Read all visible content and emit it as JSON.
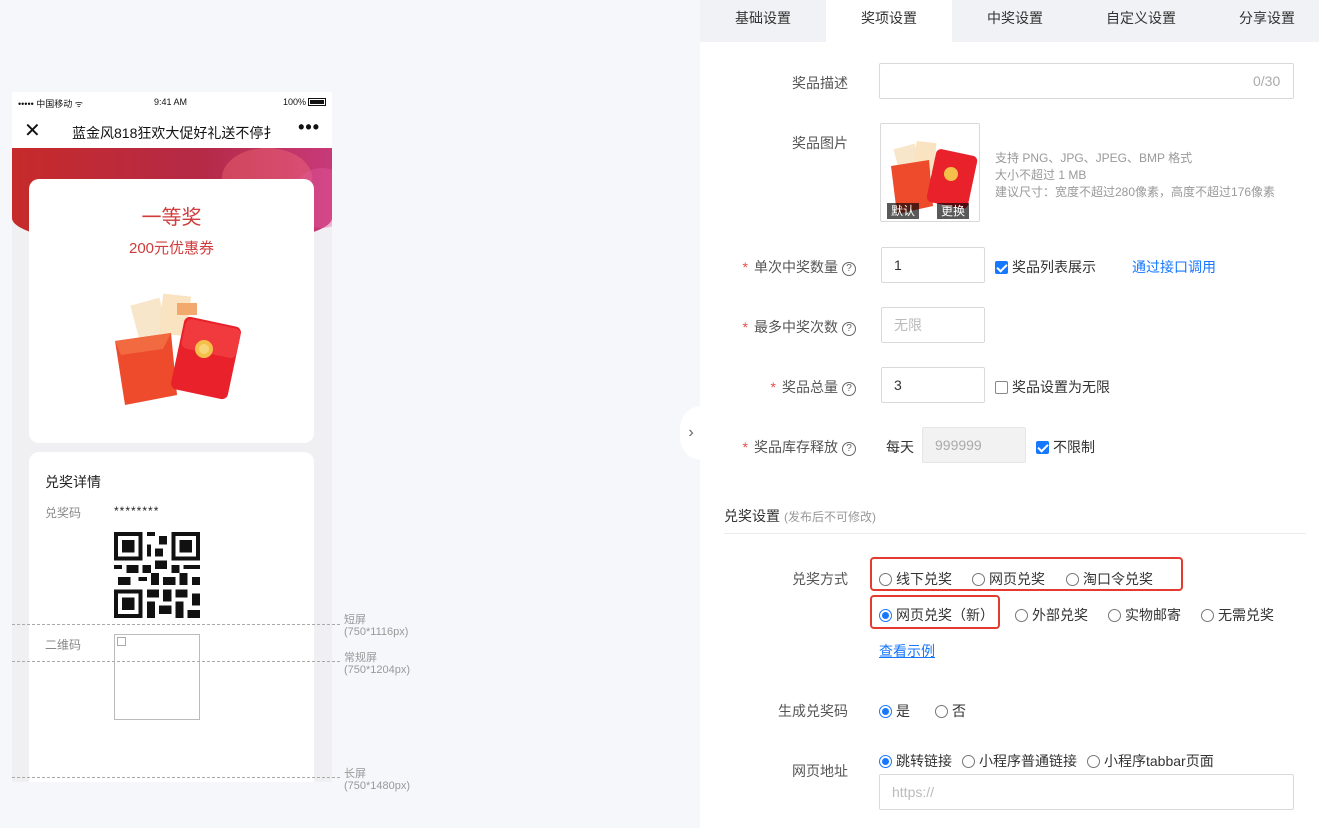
{
  "preview": {
    "status": {
      "carrier": "••••• 中国移动 ᯤ",
      "time": "9:41 AM",
      "battery": "100%"
    },
    "nav_title": "蓝金风818狂欢大促好礼送不停扌",
    "close_glyph": "✕",
    "more_glyph": "•••",
    "prize_title": "一等奖",
    "prize_sub": "200元优惠券",
    "detail_title": "兑奖详情",
    "code_label": "兑奖码",
    "code_value": "********",
    "qr_label": "二维码"
  },
  "screen_marks": [
    {
      "name": "短屏",
      "size": "(750*1116px)"
    },
    {
      "name": "常规屏",
      "size": "(750*1204px)"
    },
    {
      "name": "长屏",
      "size": "(750*1480px)"
    }
  ],
  "collapse_glyph": "›",
  "tabs": [
    "基础设置",
    "奖项设置",
    "中奖设置",
    "自定义设置",
    "分享设置"
  ],
  "active_tab": 1,
  "form": {
    "desc_label": "奖品描述",
    "desc_value": "",
    "desc_counter": "0/30",
    "image_label": "奖品图片",
    "image_default_btn": "默认",
    "image_change_btn": "更换",
    "image_tips": [
      "支持 PNG、JPG、JPEG、BMP 格式",
      "大小不超过 1 MB",
      "建议尺寸：宽度不超过280像素，高度不超过176像素"
    ],
    "single_label": "单次中奖数量",
    "single_value": "1",
    "single_show_list": "奖品列表展示",
    "single_link": "通过接口调用",
    "max_label": "最多中奖次数",
    "max_placeholder": "无限",
    "total_label": "奖品总量",
    "total_value": "3",
    "total_unlimited": "奖品设置为无限",
    "stock_label": "奖品库存释放",
    "stock_prefix": "每天",
    "stock_value": "999999",
    "stock_unlimited": "不限制",
    "required_mark": "*",
    "help_glyph": "?"
  },
  "redeem": {
    "section_title": "兑奖设置",
    "section_note": "(发布后不可修改)",
    "method_label": "兑奖方式",
    "method_options_row1": [
      "线下兑奖",
      "网页兑奖",
      "淘口令兑奖"
    ],
    "method_options_row2": [
      "网页兑奖（新）",
      "外部兑奖",
      "实物邮寄",
      "无需兑奖"
    ],
    "method_selected": "网页兑奖（新）",
    "example_link": "查看示例",
    "gen_code_label": "生成兑奖码",
    "gen_code_options": [
      "是",
      "否"
    ],
    "gen_code_selected": "是",
    "url_label": "网页地址",
    "url_options": [
      "跳转链接",
      "小程序普通链接",
      "小程序tabbar页面"
    ],
    "url_selected": "跳转链接",
    "url_placeholder": "https://"
  }
}
